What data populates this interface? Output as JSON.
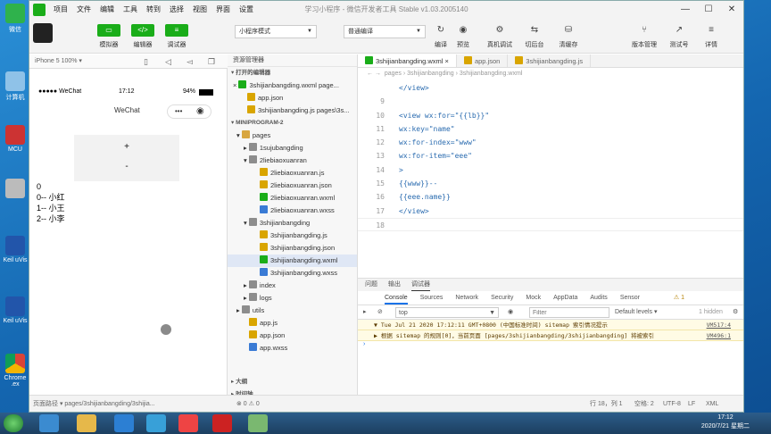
{
  "window": {
    "title": "学习小程序 - 微信开发者工具 Stable v1.03.2005140"
  },
  "menu": [
    "项目",
    "文件",
    "编辑",
    "工具",
    "转到",
    "选择",
    "视图",
    "界面",
    "设置"
  ],
  "toolbar": {
    "simulator": "模拟器",
    "editor": "编辑器",
    "debugger": "调试器",
    "mode": "小程序模式",
    "compile": "普通编译",
    "compile_btn": "编译",
    "preview": "预览",
    "real_debug": "真机调试",
    "backend": "切后台",
    "clear_cache": "清缓存",
    "version": "版本管理",
    "test": "测试号",
    "details": "详情"
  },
  "simbar": {
    "device": "iPhone 5 100% ▾"
  },
  "phone": {
    "carrier": "●●●●● WeChat",
    "time": "17:12",
    "battery": "94%",
    "nav_title": "WeChat",
    "plus": "+",
    "minus": "-",
    "lines": [
      "0",
      "0-- 小红",
      "1-- 小王",
      "2-- 小李"
    ]
  },
  "explorer": {
    "header": "资源管理器",
    "open_section": "打开的编辑器",
    "project_section": "MINIPROGRAM-2",
    "outline": "大纲",
    "timeline": "时间轴",
    "rows": [
      {
        "t": "3shijianbangding.wxml  page...",
        "ind": 6,
        "c": "#1aad19",
        "k": "open",
        "x": "×"
      },
      {
        "t": "app.json",
        "ind": 22,
        "c": "#d9a500",
        "k": "file"
      },
      {
        "t": "3shijianbangding.js  pages\\3s...",
        "ind": 22,
        "c": "#d9a500",
        "k": "file"
      }
    ],
    "tree": [
      {
        "t": "pages",
        "ind": 10,
        "c": "#d8a640",
        "k": "dir",
        "arrow": "▾"
      },
      {
        "t": "1sujubangding",
        "ind": 18,
        "c": "#8d8d8d",
        "k": "dir",
        "arrow": "▸"
      },
      {
        "t": "2liebiaoxuanran",
        "ind": 18,
        "c": "#8d8d8d",
        "k": "dir",
        "arrow": "▾"
      },
      {
        "t": "2liebiaoxuanran.js",
        "ind": 36,
        "c": "#d9a500",
        "k": "file"
      },
      {
        "t": "2liebiaoxuanran.json",
        "ind": 36,
        "c": "#d9a500",
        "k": "file"
      },
      {
        "t": "2liebiaoxuanran.wxml",
        "ind": 36,
        "c": "#1aad19",
        "k": "file"
      },
      {
        "t": "2liebiaoxuanran.wxss",
        "ind": 36,
        "c": "#3a7bd5",
        "k": "file"
      },
      {
        "t": "3shijianbangding",
        "ind": 18,
        "c": "#8d8d8d",
        "k": "dir",
        "arrow": "▾"
      },
      {
        "t": "3shijianbangding.js",
        "ind": 36,
        "c": "#d9a500",
        "k": "file"
      },
      {
        "t": "3shijianbangding.json",
        "ind": 36,
        "c": "#d9a500",
        "k": "file"
      },
      {
        "t": "3shijianbangding.wxml",
        "ind": 36,
        "c": "#1aad19",
        "k": "file",
        "active": true
      },
      {
        "t": "3shijianbangding.wxss",
        "ind": 36,
        "c": "#3a7bd5",
        "k": "file"
      },
      {
        "t": "index",
        "ind": 18,
        "c": "#8d8d8d",
        "k": "dir",
        "arrow": "▸"
      },
      {
        "t": "logs",
        "ind": 18,
        "c": "#8d8d8d",
        "k": "dir",
        "arrow": "▸"
      },
      {
        "t": "utils",
        "ind": 10,
        "c": "#8d8d8d",
        "k": "dir",
        "arrow": "▸"
      },
      {
        "t": "app.js",
        "ind": 24,
        "c": "#d9a500",
        "k": "file"
      },
      {
        "t": "app.json",
        "ind": 24,
        "c": "#d9a500",
        "k": "file"
      },
      {
        "t": "app.wxss",
        "ind": 24,
        "c": "#3a7bd5",
        "k": "file"
      }
    ]
  },
  "editor": {
    "tabs": [
      "3shijianbangding.wxml",
      "app.json",
      "3shijianbangding.js"
    ],
    "breadcrumb": "pages › 3shijianbangding › 3shijianbangding.wxml",
    "lines": [
      {
        "n": "",
        "t": "</view>"
      },
      {
        "n": "9",
        "t": ""
      },
      {
        "n": "10",
        "t": "<view wx:for=\"{{lb}}\""
      },
      {
        "n": "11",
        "t": "wx:key=\"name\""
      },
      {
        "n": "12",
        "t": "wx:for-index=\"www\""
      },
      {
        "n": "13",
        "t": "wx:for-item=\"eee\""
      },
      {
        "n": "14",
        "t": ">"
      },
      {
        "n": "15",
        "t": "{{www}}--"
      },
      {
        "n": "16",
        "t": "{{eee.name}}"
      },
      {
        "n": "17",
        "t": "</view>"
      },
      {
        "n": "18",
        "t": ""
      }
    ]
  },
  "console": {
    "tabs": [
      "问题",
      "输出",
      "调试器"
    ],
    "devtabs": [
      "Console",
      "Sources",
      "Network",
      "Security",
      "Mock",
      "AppData",
      "Audits",
      "Sensor"
    ],
    "context": "top",
    "filter_placeholder": "Filter",
    "levels": "Default levels ▾",
    "hidden": "1 hidden",
    "warn_count": "1",
    "logs": [
      {
        "text": "▼ Tue Jul 21 2020 17:12:11 GMT+0800 (中国标准时间) sitemap 索引情况提示",
        "link": "VM517:4"
      },
      {
        "text": "  ▶ 根据 sitemap 的规则[0]，当前页面 [pages/3shijianbangding/3shijianbangding] 将被索引",
        "link": "VM496:1"
      }
    ]
  },
  "statusbar": {
    "path": "页面路径 ▾   pages/3shijianbangding/3shijia...",
    "errors": "⊗ 0 ⚠ 0",
    "pos": "行 18，列 1",
    "spaces": "空格: 2",
    "enc": "UTF-8",
    "lf": "LF",
    "lang": "XML"
  },
  "desktop": [
    "微信",
    "计算机",
    "MCU",
    "",
    "Keil uVis",
    "Keil uVis",
    "Chrome .ex"
  ],
  "taskbar": {
    "time": "17:12",
    "date": "2020/7/21 星期二"
  }
}
